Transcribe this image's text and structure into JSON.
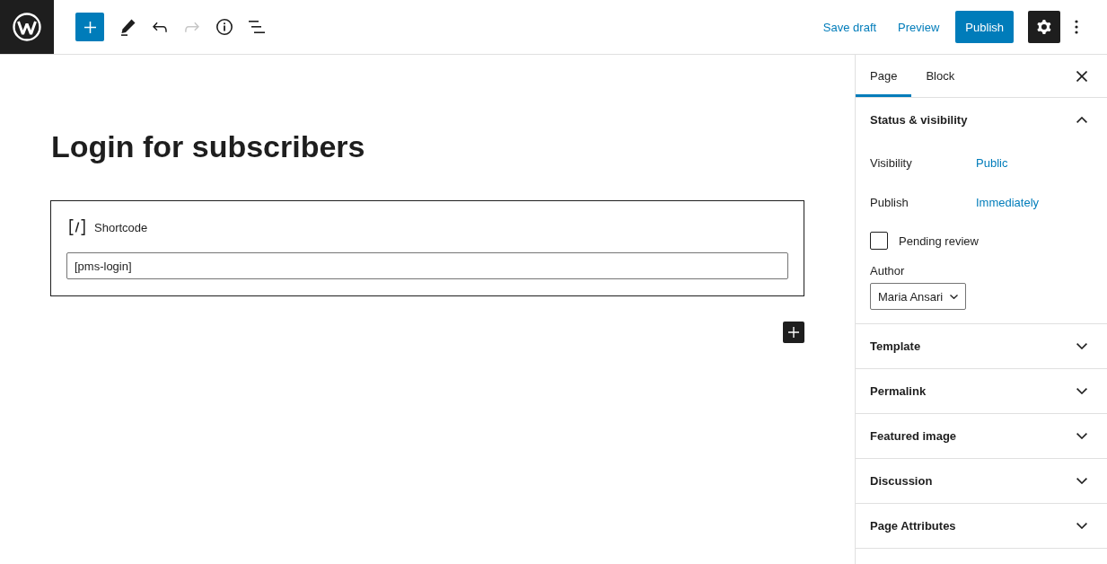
{
  "top_bar": {
    "tools": [
      {
        "kind": "inserter",
        "disabled": false
      },
      {
        "kind": "tools",
        "disabled": false
      },
      {
        "kind": "undo",
        "disabled": false
      },
      {
        "kind": "redo",
        "disabled": true
      },
      {
        "kind": "details",
        "disabled": false
      },
      {
        "kind": "list_view",
        "disabled": false
      }
    ],
    "actions": [
      {
        "kind": "link",
        "label": "Save draft"
      },
      {
        "kind": "link",
        "label": "Preview"
      },
      {
        "kind": "primary",
        "label": "Publish"
      }
    ],
    "settings": {
      "pressed": true
    }
  },
  "editor": {
    "title": "Login for subscribers",
    "blocks": [
      {
        "kind": "shortcode",
        "label": "Shortcode",
        "value": "[pms-login]"
      }
    ]
  },
  "sidebar": {
    "tabs": [
      {
        "label": "Page",
        "selected": true
      },
      {
        "label": "Block",
        "selected": false
      }
    ],
    "panels": [
      {
        "title": "Status & visibility",
        "expanded": true,
        "rows": [
          {
            "kind": "setting",
            "label": "Visibility",
            "value": "Public"
          },
          {
            "kind": "setting",
            "label": "Publish",
            "value": "Immediately"
          },
          {
            "kind": "checkbox",
            "label": "Pending review",
            "checked": false
          },
          {
            "kind": "select",
            "label": "Author",
            "value": "Maria Ansari"
          }
        ]
      },
      {
        "title": "Template",
        "expanded": false
      },
      {
        "title": "Permalink",
        "expanded": false
      },
      {
        "title": "Featured image",
        "expanded": false
      },
      {
        "title": "Discussion",
        "expanded": false
      },
      {
        "title": "Page Attributes",
        "expanded": false
      }
    ]
  }
}
